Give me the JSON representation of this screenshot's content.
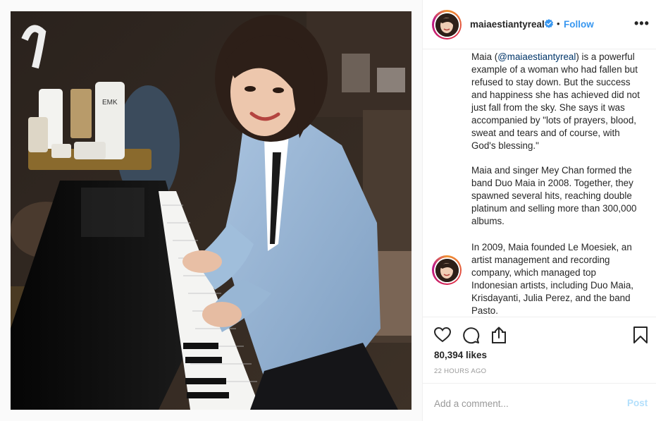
{
  "post": {
    "username": "maiaestiantyreal",
    "follow_label": "Follow",
    "separator": "•",
    "more_label": "•••"
  },
  "caption": {
    "p1_prefix": "Maia (",
    "p1_mention": "@maiaestiantyreal",
    "p1_suffix": ") is a powerful example of a woman who had fallen but refused to stay down. But the success and happiness she has achieved did not just fall from the sky. She says it was accompanied by \"lots of prayers, blood, sweat and tears and of course, with God's blessing.\"",
    "p2": "Maia and singer Mey Chan formed the band Duo Maia in 2008. Together, they spawned several hits, reaching double platinum and selling more than 300,000 albums.",
    "p3": "In 2009, Maia founded Le Moesiek, an artist management and recording company, which managed top Indonesian artists, including Duo Maia, Krisdayanti, Julia Perez, and the band Pasto."
  },
  "engagement": {
    "likes": "80,394 likes",
    "timestamp": "22 HOURS AGO"
  },
  "add_comment": {
    "placeholder": "Add a comment...",
    "post_label": "Post"
  },
  "photo": {
    "bottle_label": "EMK"
  },
  "colors": {
    "link": "#3897f0",
    "verified": "#3897f0",
    "post_disabled": "#b2dffc",
    "jacket": "#9ab8d6"
  },
  "icons": [
    "verified-badge-icon",
    "more-options-icon",
    "heart-icon",
    "comment-bubble-icon",
    "share-icon",
    "bookmark-icon"
  ]
}
